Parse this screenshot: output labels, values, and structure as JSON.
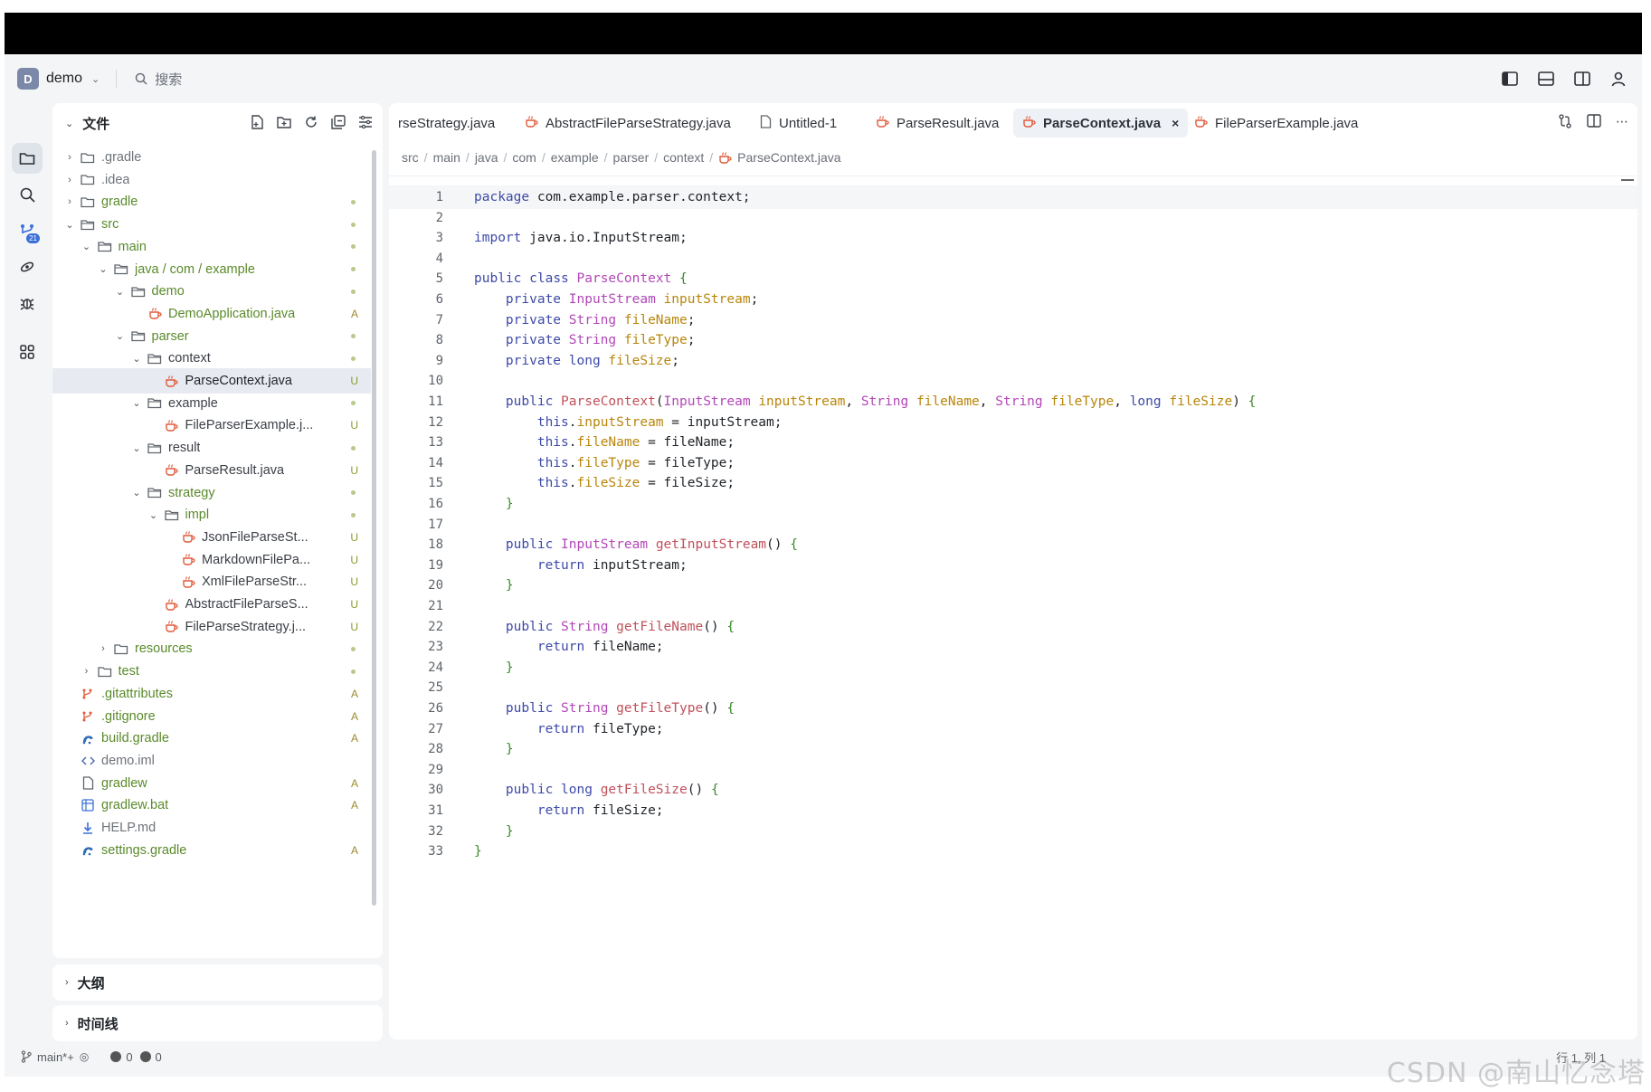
{
  "header": {
    "project_initial": "D",
    "project_name": "demo",
    "search_label": "搜索"
  },
  "sidebar": {
    "files_title": "文件",
    "tree": [
      {
        "label": ".gradle",
        "depth": 0,
        "kind": "folder",
        "open": false,
        "status": "",
        "style": "dim"
      },
      {
        "label": ".idea",
        "depth": 0,
        "kind": "folder",
        "open": false,
        "status": "",
        "style": "dim"
      },
      {
        "label": "gradle",
        "depth": 0,
        "kind": "folder",
        "open": false,
        "status": "dot",
        "style": "green"
      },
      {
        "label": "src",
        "depth": 0,
        "kind": "folder",
        "open": true,
        "status": "dot",
        "style": "green"
      },
      {
        "label": "main",
        "depth": 1,
        "kind": "folder",
        "open": true,
        "status": "dot",
        "style": "green"
      },
      {
        "label": "java / com / example",
        "depth": 2,
        "kind": "folder",
        "open": true,
        "status": "dot",
        "style": "green"
      },
      {
        "label": "demo",
        "depth": 3,
        "kind": "folder",
        "open": true,
        "status": "dot",
        "style": "green"
      },
      {
        "label": "DemoApplication.java",
        "depth": 4,
        "kind": "java",
        "status": "A",
        "style": "green"
      },
      {
        "label": "parser",
        "depth": 3,
        "kind": "folder",
        "open": true,
        "status": "dot",
        "style": "green"
      },
      {
        "label": "context",
        "depth": 4,
        "kind": "folder",
        "open": true,
        "status": "dot",
        "style": ""
      },
      {
        "label": "ParseContext.java",
        "depth": 5,
        "kind": "java",
        "status": "U",
        "style": "",
        "selected": true
      },
      {
        "label": "example",
        "depth": 4,
        "kind": "folder",
        "open": true,
        "status": "dot",
        "style": ""
      },
      {
        "label": "FileParserExample.j...",
        "depth": 5,
        "kind": "java",
        "status": "U",
        "style": ""
      },
      {
        "label": "result",
        "depth": 4,
        "kind": "folder",
        "open": true,
        "status": "dot",
        "style": ""
      },
      {
        "label": "ParseResult.java",
        "depth": 5,
        "kind": "java",
        "status": "U",
        "style": ""
      },
      {
        "label": "strategy",
        "depth": 4,
        "kind": "folder",
        "open": true,
        "status": "dot",
        "style": "green"
      },
      {
        "label": "impl",
        "depth": 5,
        "kind": "folder",
        "open": true,
        "status": "dot",
        "style": "green"
      },
      {
        "label": "JsonFileParseSt...",
        "depth": 6,
        "kind": "java",
        "status": "U",
        "style": ""
      },
      {
        "label": "MarkdownFilePa...",
        "depth": 6,
        "kind": "java",
        "status": "U",
        "style": ""
      },
      {
        "label": "XmlFileParseStr...",
        "depth": 6,
        "kind": "java",
        "status": "U",
        "style": ""
      },
      {
        "label": "AbstractFileParseS...",
        "depth": 5,
        "kind": "java",
        "status": "U",
        "style": ""
      },
      {
        "label": "FileParseStrategy.j...",
        "depth": 5,
        "kind": "java",
        "status": "U",
        "style": ""
      },
      {
        "label": "resources",
        "depth": 2,
        "kind": "folder",
        "open": false,
        "status": "dot",
        "style": "green"
      },
      {
        "label": "test",
        "depth": 1,
        "kind": "folder",
        "open": false,
        "status": "dot",
        "style": "green"
      },
      {
        "label": ".gitattributes",
        "depth": 0,
        "kind": "git",
        "status": "A",
        "style": "green"
      },
      {
        "label": ".gitignore",
        "depth": 0,
        "kind": "git",
        "status": "A",
        "style": "green"
      },
      {
        "label": "build.gradle",
        "depth": 0,
        "kind": "gradle",
        "status": "A",
        "style": "green"
      },
      {
        "label": "demo.iml",
        "depth": 0,
        "kind": "xml",
        "status": "",
        "style": "dim"
      },
      {
        "label": "gradlew",
        "depth": 0,
        "kind": "file",
        "status": "A",
        "style": "green"
      },
      {
        "label": "gradlew.bat",
        "depth": 0,
        "kind": "bat",
        "status": "A",
        "style": "green"
      },
      {
        "label": "HELP.md",
        "depth": 0,
        "kind": "md",
        "status": "",
        "style": "dim"
      },
      {
        "label": "settings.gradle",
        "depth": 0,
        "kind": "gradle",
        "status": "A",
        "style": "green"
      }
    ],
    "outline_title": "大纲",
    "timeline_title": "时间线"
  },
  "editor": {
    "tabs": [
      {
        "label": "rseStrategy.java",
        "icon": "none",
        "active": false
      },
      {
        "label": "AbstractFileParseStrategy.java",
        "icon": "java",
        "active": false
      },
      {
        "label": "Untitled-1",
        "icon": "file",
        "active": false
      },
      {
        "label": "ParseResult.java",
        "icon": "java",
        "active": false
      },
      {
        "label": "ParseContext.java",
        "icon": "java",
        "active": true
      },
      {
        "label": "FileParserExample.java",
        "icon": "java",
        "active": false
      }
    ],
    "breadcrumb": [
      "src",
      "main",
      "java",
      "com",
      "example",
      "parser",
      "context",
      "ParseContext.java"
    ],
    "lines": [
      "package com.example.parser.context;",
      "",
      "import java.io.InputStream;",
      "",
      "public class ParseContext {",
      "    private InputStream inputStream;",
      "    private String fileName;",
      "    private String fileType;",
      "    private long fileSize;",
      "",
      "    public ParseContext(InputStream inputStream, String fileName, String fileType, long fileSize) {",
      "        this.inputStream = inputStream;",
      "        this.fileName = fileName;",
      "        this.fileType = fileType;",
      "        this.fileSize = fileSize;",
      "    }",
      "",
      "    public InputStream getInputStream() {",
      "        return inputStream;",
      "    }",
      "",
      "    public String getFileName() {",
      "        return fileName;",
      "    }",
      "",
      "    public String getFileType() {",
      "        return fileType;",
      "    }",
      "",
      "    public long getFileSize() {",
      "        return fileSize;",
      "    }",
      "}"
    ]
  },
  "status": {
    "branch": "main*+",
    "errors": "0",
    "warnings": "0",
    "position": "行 1, 列 1",
    "watermark": "CSDN @南山忆念塔"
  },
  "colors": {
    "keyword": "#3d4aa8",
    "type": "#b247b8",
    "field": "#b8860b",
    "method": "#c0505a",
    "brace": "#3a8a2a",
    "java_icon": "#e05a3a"
  }
}
